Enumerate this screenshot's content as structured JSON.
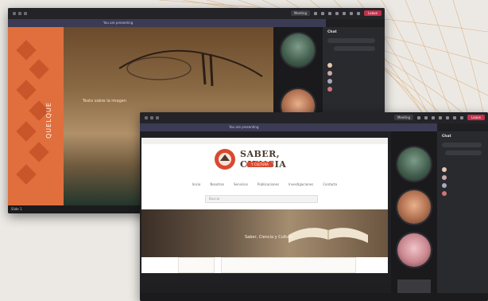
{
  "back_window": {
    "titlebar": {
      "meeting_button": "Meeting",
      "leave_button": "Leave"
    },
    "banner": "You are presenting",
    "slide": {
      "vertical_label": "QUELQUE",
      "caption": "Texto sobre la imagen"
    },
    "participants": [
      "",
      "",
      "",
      ""
    ],
    "chat_title": "Chat",
    "status_left": "Slide 1"
  },
  "front_window": {
    "titlebar": {
      "meeting_button": "Meeting",
      "leave_button": "Leave"
    },
    "banner": "You are presenting",
    "site": {
      "logo_title": "SABER, CIENCIA",
      "logo_sub": "Y CULTURA",
      "nav": [
        "Inicio",
        "Nosotros",
        "Servicios",
        "Publicaciones",
        "Investigaciones",
        "Contacto"
      ],
      "search_placeholder": "Buscar",
      "hero_text": "Saber, Ciencia y Cultura"
    },
    "chat_title": "Chat",
    "participants": [
      "",
      "",
      "",
      ""
    ],
    "tile_labels": [
      "",
      "",
      ""
    ]
  },
  "colors": {
    "accent_orange": "#e06f3d",
    "leave_red": "#c4314b",
    "logo_red": "#d84a30",
    "dark_bg": "#1f1f22"
  }
}
